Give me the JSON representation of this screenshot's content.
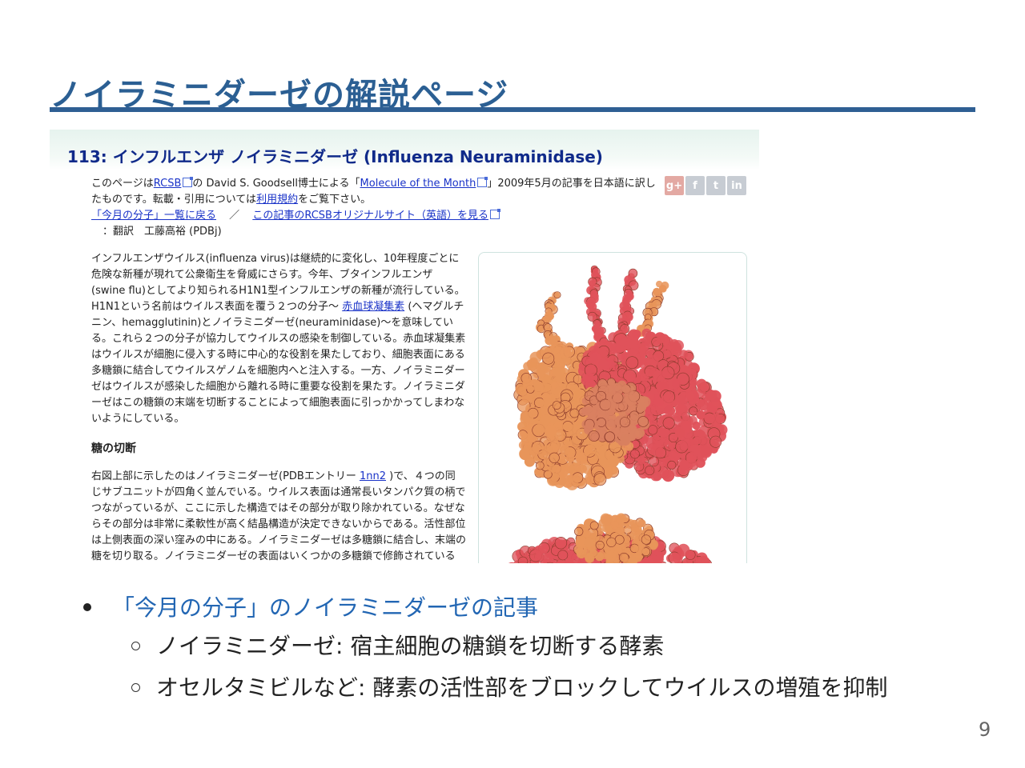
{
  "slide": {
    "title": "ノイラミニダーゼの解説ページ",
    "page_number": "9"
  },
  "screenshot": {
    "article_title": "113: インフルエンザ ノイラミニダーゼ (Influenza Neuraminidase)",
    "intro": {
      "l1_pre": "このページは",
      "rcsb_link": "RCSB",
      "l1_mid": "の David S. Goodsell博士による「",
      "motm_link": "Molecule of the Month",
      "l1_post": "」2009年5月の記事を日本語に訳し",
      "l2_pre": "たものです。転載・引用については",
      "terms_link": "利用規約",
      "l2_post": "をご覧下さい。",
      "back_link": "「今月の分子」一覧に戻る",
      "sep": "／",
      "orig_link": "この記事のRCSBオリジナルサイト（英語）を見る",
      "translator": "：翻訳　工藤高裕 (PDBj)"
    },
    "social": [
      "g+",
      "f",
      "t",
      "in"
    ],
    "para1": [
      "インフルエンザウイルス(influenza virus)は継続的に変化し、10年程度ごとに",
      "危険な新種が現れて公衆衛生を脅威にさらす。今年、ブタインフルエンザ",
      "(swine flu)としてより知られるH1N1型インフルエンザの新種が流行している。",
      "H1N1という名前はウイルス表面を覆う２つの分子〜 ",
      "赤血球凝集素",
      " (ヘマグルチ",
      "ニン、hemagglutinin)とノイラミニダーゼ(neuraminidase)〜を意味してい",
      "る。これら２つの分子が協力してウイルスの感染を制御している。赤血球凝集素",
      "はウイルスが細胞に侵入する時に中心的な役割を果たしており、細胞表面にある",
      "多糖鎖に結合してウイルスゲノムを細胞内へと注入する。一方、ノイラミニダー",
      "ゼはウイルスが感染した細胞から離れる時に重要な役割を果たす。ノイラミニダ",
      "ーゼはこの糖鎖の末端を切断することによって細胞表面に引っかかってしまわな",
      "いようにしている。"
    ],
    "section_heading": "糖の切断",
    "para2": {
      "l1_pre": "右図上部に示したのはノイラミニダーゼ(PDBエントリー ",
      "pdb_link": "1nn2",
      "l1_post": " )で、４つの同",
      "lines": [
        "じサブユニットが四角く並んでいる。ウイルス表面は通常長いタンパク質の柄で",
        "つながっているが、ここに示した構造ではその部分が取り除かれている。なぜな",
        "らその部分は非常に柔軟性が高く結晶構造が決定できないからである。活性部位",
        "は上側表面の深い窪みの中にある。ノイラミニダーゼは多糖鎖に結合し、末端の",
        "糖を切り取る。ノイラミニダーゼの表面はいくつかの多糖鎖で修飾されている"
      ]
    }
  },
  "bullets": {
    "main": "「今月の分子」のノイラミニダーゼの記事",
    "sub": [
      "ノイラミニダーゼ: 宿主細胞の糖鎖を切断する酵素",
      "オセルタミビルなど: 酵素の活性部をブロックしてウイルスの増殖を抑制"
    ]
  },
  "colors": {
    "title_blue": "#2b5f93",
    "rule_blue": "#2f5f93",
    "link_blue": "#1a33c8",
    "bullet_blue": "#2266b3",
    "protein_orange": "#e8955a",
    "protein_red": "#e0525a"
  }
}
